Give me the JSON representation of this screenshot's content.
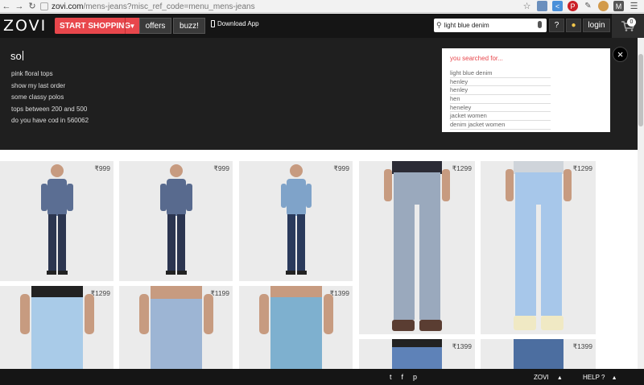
{
  "browser": {
    "url_domain": "zovi.com",
    "url_path": "/mens-jeans?misc_ref_code=menu_mens-jeans",
    "extensions": [
      "screen-share-icon",
      "code-icon",
      "pinterest-icon",
      "pen-icon",
      "cookie-icon",
      "gmail-icon",
      "menu-icon"
    ]
  },
  "header": {
    "logo": "ZOVI",
    "start_shopping": "START SHOPPING",
    "offers": "offers",
    "buzz": "buzz!",
    "download_app": "Download App",
    "search_value": "light blue denim",
    "help": "?",
    "login": "login",
    "cart_count": "0"
  },
  "overlay": {
    "typed_query": "so",
    "suggestions": [
      "pink floral tops",
      "show my last order",
      "some classy polos",
      "tops between 200 and 500",
      "do you have cod in 560062"
    ],
    "history_title": "you searched for...",
    "history": [
      "light blue denim",
      "henley",
      "henley",
      "hen",
      "heneley",
      "jacket women",
      "denim jacket women"
    ],
    "close": "×"
  },
  "products": [
    {
      "price": "₹999",
      "shirt": "#5b6e93",
      "pants": "#2c3650"
    },
    {
      "price": "₹999",
      "shirt": "#586a8e",
      "pants": "#2b3550"
    },
    {
      "price": "₹999",
      "shirt": "#7fa3c9",
      "pants": "#2a3a5c"
    },
    {
      "price": "₹1299",
      "shirt": "#2b2b35",
      "pants": "#9aa9bd"
    },
    {
      "price": "₹1299",
      "shirt": "#cfd4da",
      "pants": "#a7c7ea"
    },
    {
      "price": "₹1299",
      "shirt": "#e9e9e9",
      "pants": "#a9cbe8"
    },
    {
      "price": "₹1199",
      "shirt": "#e9e9e9",
      "pants": "#9db5d4"
    },
    {
      "price": "₹1399",
      "shirt": "#e9e9e9",
      "pants": "#7eb0cf"
    },
    {
      "price": "₹1399",
      "shirt": "#e9e9e9",
      "pants": "#5e82b8"
    },
    {
      "price": "₹1399",
      "shirt": "#e9e9e9",
      "pants": "#4c6ea0"
    }
  ],
  "footer": {
    "social": [
      "t",
      "f",
      "p"
    ],
    "brand": "ZOVI",
    "help": "HELP ?"
  },
  "colors": {
    "accent": "#e8474c",
    "header_bg": "#151515",
    "overlay_bg": "#1f1f1f"
  }
}
